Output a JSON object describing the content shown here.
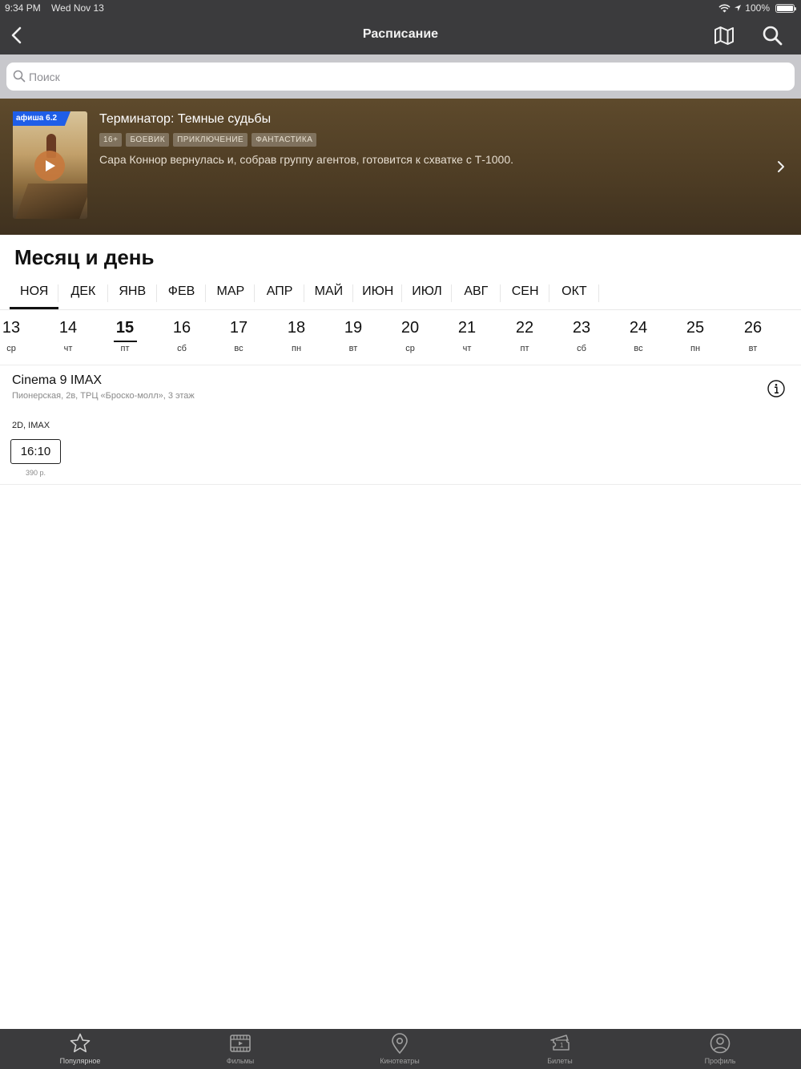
{
  "status_bar": {
    "time": "9:34 PM",
    "date": "Wed Nov 13",
    "battery": "100%"
  },
  "nav": {
    "title": "Расписание"
  },
  "search": {
    "placeholder": "Поиск"
  },
  "movie": {
    "badge": "афиша 6.2",
    "title": "Терминатор: Темные судьбы",
    "tags": [
      "16+",
      "БОЕВИК",
      "ПРИКЛЮЧЕНИЕ",
      "ФАНТАСТИКА"
    ],
    "description": "Сара Коннор вернулась и, собрав группу агентов, готовится к схватке с Т-1000."
  },
  "section_title": "Месяц и день",
  "months": [
    "НОЯ",
    "ДЕК",
    "ЯНВ",
    "ФЕВ",
    "МАР",
    "АПР",
    "МАЙ",
    "ИЮН",
    "ИЮЛ",
    "АВГ",
    "СЕН",
    "ОКТ"
  ],
  "active_month": "НОЯ",
  "days": [
    {
      "num": "13",
      "wd": "ср"
    },
    {
      "num": "14",
      "wd": "чт"
    },
    {
      "num": "15",
      "wd": "пт"
    },
    {
      "num": "16",
      "wd": "сб"
    },
    {
      "num": "17",
      "wd": "вс"
    },
    {
      "num": "18",
      "wd": "пн"
    },
    {
      "num": "19",
      "wd": "вт"
    },
    {
      "num": "20",
      "wd": "ср"
    },
    {
      "num": "21",
      "wd": "чт"
    },
    {
      "num": "22",
      "wd": "пт"
    },
    {
      "num": "23",
      "wd": "сб"
    },
    {
      "num": "24",
      "wd": "вс"
    },
    {
      "num": "25",
      "wd": "пн"
    },
    {
      "num": "26",
      "wd": "вт"
    }
  ],
  "active_day": "15",
  "cinema": {
    "name": "Cinema 9 IMAX",
    "address": "Пионерская, 2в, ТРЦ «Броско-молл», 3 этаж",
    "format": "2D, IMAX",
    "session_time": "16:10",
    "session_price": "390 р."
  },
  "tabs": [
    {
      "label": "Популярное",
      "icon": "star-icon"
    },
    {
      "label": "Фильмы",
      "icon": "film-icon"
    },
    {
      "label": "Кинотеатры",
      "icon": "location-pin-icon"
    },
    {
      "label": "Билеты",
      "icon": "ticket-icon"
    },
    {
      "label": "Профиль",
      "icon": "profile-icon"
    }
  ],
  "colors": {
    "bar_bg": "#3b3b3d",
    "banner_bg": "#5e4a2c",
    "badge": "#1f5ee8",
    "play": "#c8783c"
  }
}
